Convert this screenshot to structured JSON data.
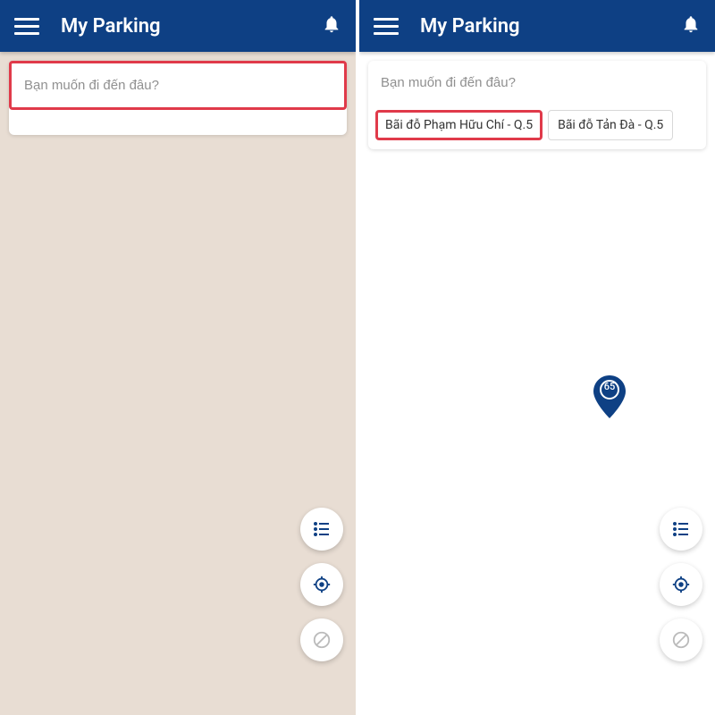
{
  "header": {
    "title": "My Parking"
  },
  "search": {
    "placeholder": "Bạn muốn đi đến đâu?"
  },
  "suggestions": [
    {
      "label": "Bãi đỗ Phạm Hữu Chí - Q.5"
    },
    {
      "label": "Bãi đỗ Tản Đà - Q.5"
    }
  ],
  "map": {
    "pin_label": "65"
  },
  "colors": {
    "primary": "#0e4084",
    "highlight": "#e03a4a"
  }
}
